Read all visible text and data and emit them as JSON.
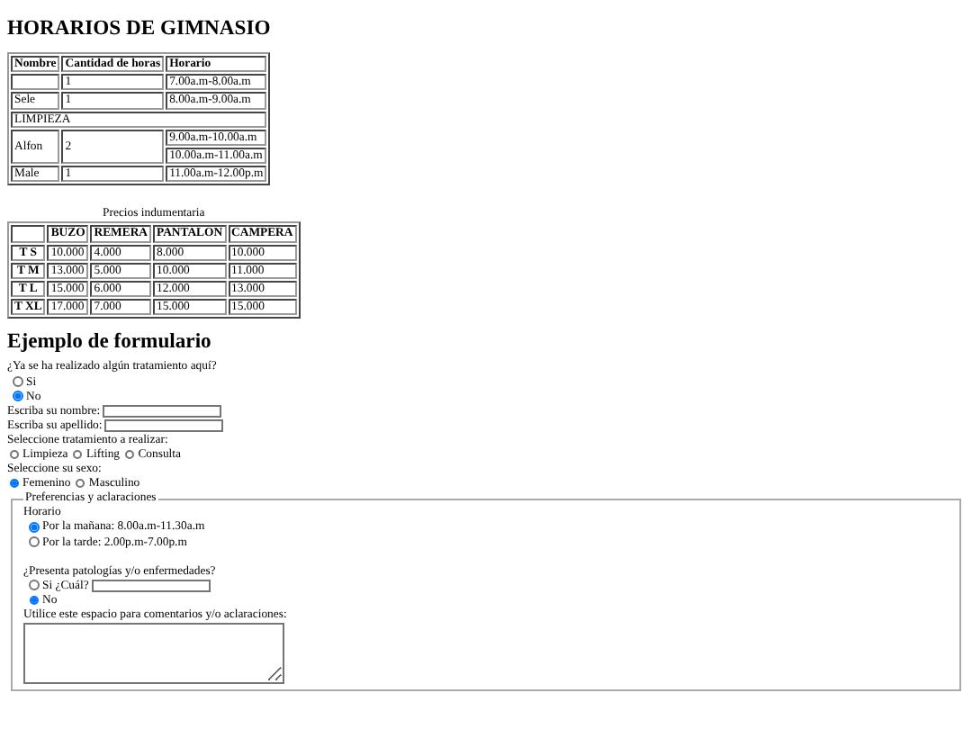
{
  "title": "HORARIOS DE GIMNASIO",
  "schedule_table": {
    "columns": [
      "Nombre",
      "Cantidad de horas",
      "Horario"
    ],
    "rows": [
      {
        "kind": "entry",
        "nombre": "",
        "horas": "1",
        "horarios": [
          "7.00a.m-8.00a.m"
        ]
      },
      {
        "kind": "entry",
        "nombre": "Sele",
        "horas": "1",
        "horarios": [
          "8.00a.m-9.00a.m"
        ]
      },
      {
        "kind": "section",
        "label": "LIMPIEZA"
      },
      {
        "kind": "entry",
        "nombre": "Alfon",
        "horas": "2",
        "horarios": [
          "9.00a.m-10.00a.m",
          "10.00a.m-11.00a.m"
        ]
      },
      {
        "kind": "entry",
        "nombre": "Male",
        "horas": "1",
        "horarios": [
          "11.00a.m-12.00p.m"
        ]
      }
    ]
  },
  "prices_table": {
    "caption": "Precios indumentaria",
    "columns": [
      "BUZO",
      "REMERA",
      "PANTALON",
      "CAMPERA"
    ],
    "rows": [
      {
        "size": "T S",
        "values": [
          "10.000",
          "4.000",
          "8.000",
          "10.000"
        ]
      },
      {
        "size": "T M",
        "values": [
          "13.000",
          "5.000",
          "10.000",
          "11.000"
        ]
      },
      {
        "size": "T L",
        "values": [
          "15.000",
          "6.000",
          "12.000",
          "13.000"
        ]
      },
      {
        "size": "T XL",
        "values": [
          "17.000",
          "7.000",
          "15.000",
          "15.000"
        ]
      }
    ]
  },
  "form": {
    "heading": "Ejemplo de formulario",
    "items": [
      {
        "kind": "radio-list",
        "label": "¿Ya se ha realizado algún tratamiento aquí?",
        "options": [
          {
            "label": "Si",
            "selected": false
          },
          {
            "label": "No",
            "selected": true
          }
        ]
      },
      {
        "kind": "text",
        "label": "Escriba su nombre:"
      },
      {
        "kind": "text",
        "label": "Escriba su apellido:"
      },
      {
        "kind": "checkbox-group",
        "label": "Seleccione tratamiento a realizar:",
        "options": [
          {
            "label": "Limpieza",
            "checked": false
          },
          {
            "label": "Lifting",
            "checked": false
          },
          {
            "label": "Consulta",
            "checked": false
          }
        ]
      },
      {
        "kind": "radio-row",
        "label": "Seleccione su sexo:",
        "options": [
          {
            "label": "Femenino",
            "selected": true
          },
          {
            "label": "Masculino",
            "selected": false
          }
        ]
      },
      {
        "kind": "fieldset",
        "legend": "Preferencias y aclaraciones",
        "items": [
          {
            "kind": "radio-list",
            "label": "Horario",
            "options": [
              {
                "label": "Por la mañana: 8.00a.m-11.30a.m",
                "selected": true
              },
              {
                "label": "Por la tarde: 2.00p.m-7.00p.m",
                "selected": false
              }
            ]
          },
          {
            "kind": "radio-list",
            "label": "¿Presenta patologías y/o enfermedades?",
            "options": [
              {
                "label": "Si ¿Cuál?",
                "selected": false,
                "with_field": true
              },
              {
                "label": "No",
                "selected": true
              }
            ]
          },
          {
            "kind": "textarea",
            "label": "Utilice este espacio para comentarios y/o aclaraciones:"
          }
        ]
      }
    ]
  }
}
